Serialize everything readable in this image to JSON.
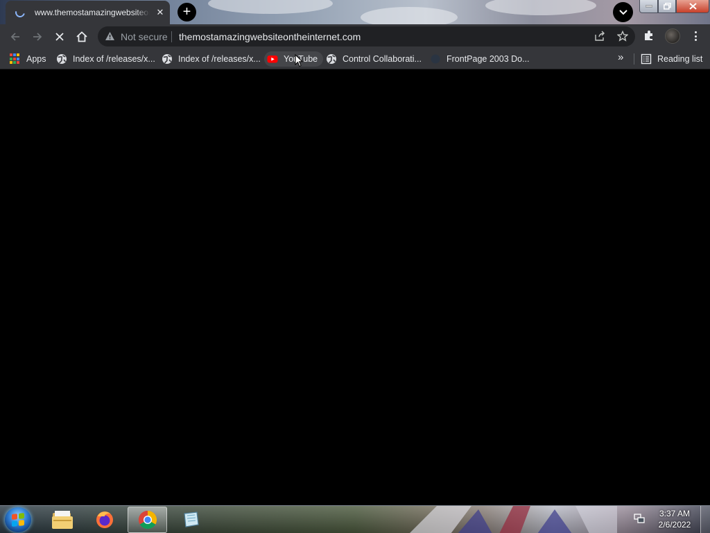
{
  "tab": {
    "title": "www.themostamazingwebsiteontheinternet.com"
  },
  "omnibox": {
    "security_label": "Not secure",
    "url": "themostamazingwebsiteontheinternet.com"
  },
  "bookmarks": {
    "items": [
      {
        "label": "Apps",
        "icon": "apps-grid-icon"
      },
      {
        "label": "Index of /releases/x...",
        "icon": "globe-icon"
      },
      {
        "label": "Index of /releases/x...",
        "icon": "globe-icon"
      },
      {
        "label": "YouTube",
        "icon": "youtube-icon"
      },
      {
        "label": "Control Collaborati...",
        "icon": "globe-icon"
      },
      {
        "label": "FrontPage 2003 Do...",
        "icon": "frontpage-icon"
      }
    ],
    "overflow": "»",
    "reading_list": "Reading list"
  },
  "taskbar": {
    "time": "3:37 AM",
    "date": "2/6/2022"
  },
  "colors": {
    "tab_bg": "#35363a",
    "omnibox_bg": "#202124",
    "page_bg": "#000000",
    "accent": "#8ab4f8",
    "youtube_red": "#ff0000"
  }
}
